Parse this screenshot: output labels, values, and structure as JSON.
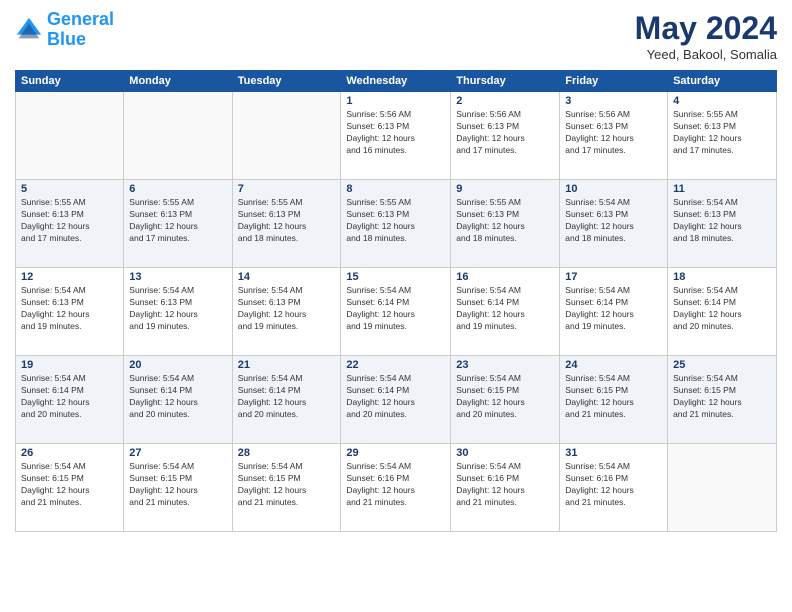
{
  "logo": {
    "text1": "General",
    "text2": "Blue"
  },
  "title": "May 2024",
  "subtitle": "Yeed, Bakool, Somalia",
  "days_of_week": [
    "Sunday",
    "Monday",
    "Tuesday",
    "Wednesday",
    "Thursday",
    "Friday",
    "Saturday"
  ],
  "weeks": [
    [
      {
        "num": "",
        "info": ""
      },
      {
        "num": "",
        "info": ""
      },
      {
        "num": "",
        "info": ""
      },
      {
        "num": "1",
        "info": "Sunrise: 5:56 AM\nSunset: 6:13 PM\nDaylight: 12 hours\nand 16 minutes."
      },
      {
        "num": "2",
        "info": "Sunrise: 5:56 AM\nSunset: 6:13 PM\nDaylight: 12 hours\nand 17 minutes."
      },
      {
        "num": "3",
        "info": "Sunrise: 5:56 AM\nSunset: 6:13 PM\nDaylight: 12 hours\nand 17 minutes."
      },
      {
        "num": "4",
        "info": "Sunrise: 5:55 AM\nSunset: 6:13 PM\nDaylight: 12 hours\nand 17 minutes."
      }
    ],
    [
      {
        "num": "5",
        "info": "Sunrise: 5:55 AM\nSunset: 6:13 PM\nDaylight: 12 hours\nand 17 minutes."
      },
      {
        "num": "6",
        "info": "Sunrise: 5:55 AM\nSunset: 6:13 PM\nDaylight: 12 hours\nand 17 minutes."
      },
      {
        "num": "7",
        "info": "Sunrise: 5:55 AM\nSunset: 6:13 PM\nDaylight: 12 hours\nand 18 minutes."
      },
      {
        "num": "8",
        "info": "Sunrise: 5:55 AM\nSunset: 6:13 PM\nDaylight: 12 hours\nand 18 minutes."
      },
      {
        "num": "9",
        "info": "Sunrise: 5:55 AM\nSunset: 6:13 PM\nDaylight: 12 hours\nand 18 minutes."
      },
      {
        "num": "10",
        "info": "Sunrise: 5:54 AM\nSunset: 6:13 PM\nDaylight: 12 hours\nand 18 minutes."
      },
      {
        "num": "11",
        "info": "Sunrise: 5:54 AM\nSunset: 6:13 PM\nDaylight: 12 hours\nand 18 minutes."
      }
    ],
    [
      {
        "num": "12",
        "info": "Sunrise: 5:54 AM\nSunset: 6:13 PM\nDaylight: 12 hours\nand 19 minutes."
      },
      {
        "num": "13",
        "info": "Sunrise: 5:54 AM\nSunset: 6:13 PM\nDaylight: 12 hours\nand 19 minutes."
      },
      {
        "num": "14",
        "info": "Sunrise: 5:54 AM\nSunset: 6:13 PM\nDaylight: 12 hours\nand 19 minutes."
      },
      {
        "num": "15",
        "info": "Sunrise: 5:54 AM\nSunset: 6:14 PM\nDaylight: 12 hours\nand 19 minutes."
      },
      {
        "num": "16",
        "info": "Sunrise: 5:54 AM\nSunset: 6:14 PM\nDaylight: 12 hours\nand 19 minutes."
      },
      {
        "num": "17",
        "info": "Sunrise: 5:54 AM\nSunset: 6:14 PM\nDaylight: 12 hours\nand 19 minutes."
      },
      {
        "num": "18",
        "info": "Sunrise: 5:54 AM\nSunset: 6:14 PM\nDaylight: 12 hours\nand 20 minutes."
      }
    ],
    [
      {
        "num": "19",
        "info": "Sunrise: 5:54 AM\nSunset: 6:14 PM\nDaylight: 12 hours\nand 20 minutes."
      },
      {
        "num": "20",
        "info": "Sunrise: 5:54 AM\nSunset: 6:14 PM\nDaylight: 12 hours\nand 20 minutes."
      },
      {
        "num": "21",
        "info": "Sunrise: 5:54 AM\nSunset: 6:14 PM\nDaylight: 12 hours\nand 20 minutes."
      },
      {
        "num": "22",
        "info": "Sunrise: 5:54 AM\nSunset: 6:14 PM\nDaylight: 12 hours\nand 20 minutes."
      },
      {
        "num": "23",
        "info": "Sunrise: 5:54 AM\nSunset: 6:15 PM\nDaylight: 12 hours\nand 20 minutes."
      },
      {
        "num": "24",
        "info": "Sunrise: 5:54 AM\nSunset: 6:15 PM\nDaylight: 12 hours\nand 21 minutes."
      },
      {
        "num": "25",
        "info": "Sunrise: 5:54 AM\nSunset: 6:15 PM\nDaylight: 12 hours\nand 21 minutes."
      }
    ],
    [
      {
        "num": "26",
        "info": "Sunrise: 5:54 AM\nSunset: 6:15 PM\nDaylight: 12 hours\nand 21 minutes."
      },
      {
        "num": "27",
        "info": "Sunrise: 5:54 AM\nSunset: 6:15 PM\nDaylight: 12 hours\nand 21 minutes."
      },
      {
        "num": "28",
        "info": "Sunrise: 5:54 AM\nSunset: 6:15 PM\nDaylight: 12 hours\nand 21 minutes."
      },
      {
        "num": "29",
        "info": "Sunrise: 5:54 AM\nSunset: 6:16 PM\nDaylight: 12 hours\nand 21 minutes."
      },
      {
        "num": "30",
        "info": "Sunrise: 5:54 AM\nSunset: 6:16 PM\nDaylight: 12 hours\nand 21 minutes."
      },
      {
        "num": "31",
        "info": "Sunrise: 5:54 AM\nSunset: 6:16 PM\nDaylight: 12 hours\nand 21 minutes."
      },
      {
        "num": "",
        "info": ""
      }
    ]
  ]
}
